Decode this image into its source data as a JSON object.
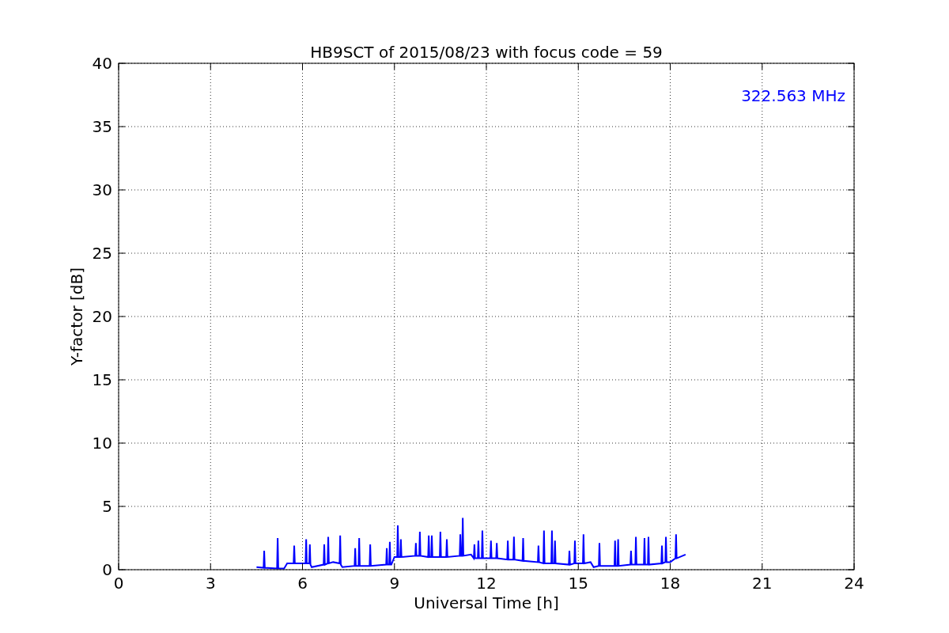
{
  "chart_data": {
    "type": "line",
    "title": "HB9SCT of 2015/08/23 with focus code = 59",
    "xlabel": "Universal Time [h]",
    "ylabel": "Y-factor [dB]",
    "xlim": [
      0,
      24
    ],
    "ylim": [
      0,
      40
    ],
    "xticks": [
      0,
      3,
      6,
      9,
      12,
      15,
      18,
      21,
      24
    ],
    "yticks": [
      0,
      5,
      10,
      15,
      20,
      25,
      30,
      35,
      40
    ],
    "x": [
      4.5,
      4.73,
      4.75,
      4.77,
      5.17,
      5.19,
      5.21,
      5.4,
      5.5,
      5.71,
      5.73,
      5.75,
      6.1,
      6.12,
      6.14,
      6.22,
      6.24,
      6.26,
      6.3,
      6.69,
      6.71,
      6.73,
      6.82,
      6.84,
      6.86,
      7.0,
      7.21,
      7.23,
      7.25,
      7.3,
      7.7,
      7.72,
      7.74,
      7.83,
      7.85,
      7.87,
      8.19,
      8.21,
      8.23,
      8.73,
      8.75,
      8.77,
      8.83,
      8.85,
      8.87,
      8.9,
      9.0,
      9.09,
      9.11,
      9.13,
      9.19,
      9.21,
      9.23,
      9.68,
      9.7,
      9.72,
      9.81,
      9.83,
      9.85,
      10.1,
      10.12,
      10.14,
      10.2,
      10.22,
      10.24,
      10.48,
      10.5,
      10.52,
      10.69,
      10.71,
      10.73,
      11.13,
      11.15,
      11.17,
      11.21,
      11.23,
      11.25,
      11.5,
      11.59,
      11.61,
      11.63,
      11.72,
      11.74,
      11.76,
      11.85,
      11.87,
      11.89,
      12.13,
      12.15,
      12.17,
      12.32,
      12.34,
      12.36,
      12.68,
      12.7,
      12.72,
      12.88,
      12.9,
      12.92,
      13.18,
      13.2,
      13.22,
      13.68,
      13.7,
      13.72,
      13.86,
      13.88,
      13.9,
      14.12,
      14.14,
      14.16,
      14.22,
      14.24,
      14.26,
      14.69,
      14.71,
      14.73,
      14.87,
      14.89,
      14.91,
      15.15,
      15.17,
      15.19,
      15.4,
      15.5,
      15.67,
      15.69,
      15.71,
      16.18,
      16.2,
      16.22,
      16.28,
      16.3,
      16.32,
      16.7,
      16.72,
      16.74,
      16.86,
      16.88,
      16.9,
      17.14,
      17.16,
      17.18,
      17.27,
      17.29,
      17.31,
      17.71,
      17.73,
      17.75,
      17.84,
      17.86,
      17.88,
      18.0,
      18.17,
      18.19,
      18.21,
      18.5
    ],
    "series": [
      {
        "name": "322.563 MHz",
        "color": "#0000ff",
        "values": [
          0.2,
          0.15,
          1.5,
          0.15,
          0.1,
          2.5,
          0.1,
          0.1,
          0.5,
          0.5,
          1.9,
          0.5,
          0.5,
          2.4,
          0.5,
          0.5,
          2.0,
          0.4,
          0.2,
          0.4,
          2.0,
          0.4,
          0.5,
          2.6,
          0.5,
          0.6,
          0.5,
          2.7,
          0.4,
          0.2,
          0.3,
          1.7,
          0.3,
          0.3,
          2.5,
          0.3,
          0.3,
          2.0,
          0.3,
          0.4,
          1.7,
          0.4,
          0.4,
          2.2,
          0.4,
          0.4,
          1.0,
          1.0,
          3.5,
          1.0,
          1.0,
          2.4,
          1.0,
          1.1,
          2.1,
          1.1,
          1.1,
          3.0,
          1.1,
          1.0,
          2.7,
          1.0,
          1.0,
          2.7,
          1.0,
          1.0,
          3.0,
          1.0,
          1.0,
          2.4,
          1.0,
          1.1,
          2.8,
          1.1,
          1.1,
          4.1,
          1.1,
          1.2,
          0.9,
          2.0,
          0.9,
          0.9,
          2.3,
          0.9,
          0.9,
          3.1,
          0.9,
          0.9,
          2.3,
          0.9,
          0.9,
          2.1,
          0.9,
          0.8,
          2.3,
          0.8,
          0.8,
          2.6,
          0.8,
          0.7,
          2.5,
          0.7,
          0.6,
          1.9,
          0.6,
          0.5,
          3.1,
          0.5,
          0.5,
          3.1,
          0.5,
          0.5,
          2.3,
          0.5,
          0.4,
          1.5,
          0.4,
          0.5,
          2.3,
          0.5,
          0.5,
          2.8,
          0.5,
          0.6,
          0.2,
          0.3,
          2.1,
          0.3,
          0.3,
          2.3,
          0.3,
          0.3,
          2.4,
          0.3,
          0.4,
          1.5,
          0.4,
          0.4,
          2.6,
          0.4,
          0.4,
          2.5,
          0.4,
          0.4,
          2.6,
          0.4,
          0.5,
          1.9,
          0.5,
          0.6,
          2.6,
          0.6,
          0.6,
          0.9,
          2.8,
          0.9,
          1.2
        ]
      }
    ],
    "grid": true
  }
}
